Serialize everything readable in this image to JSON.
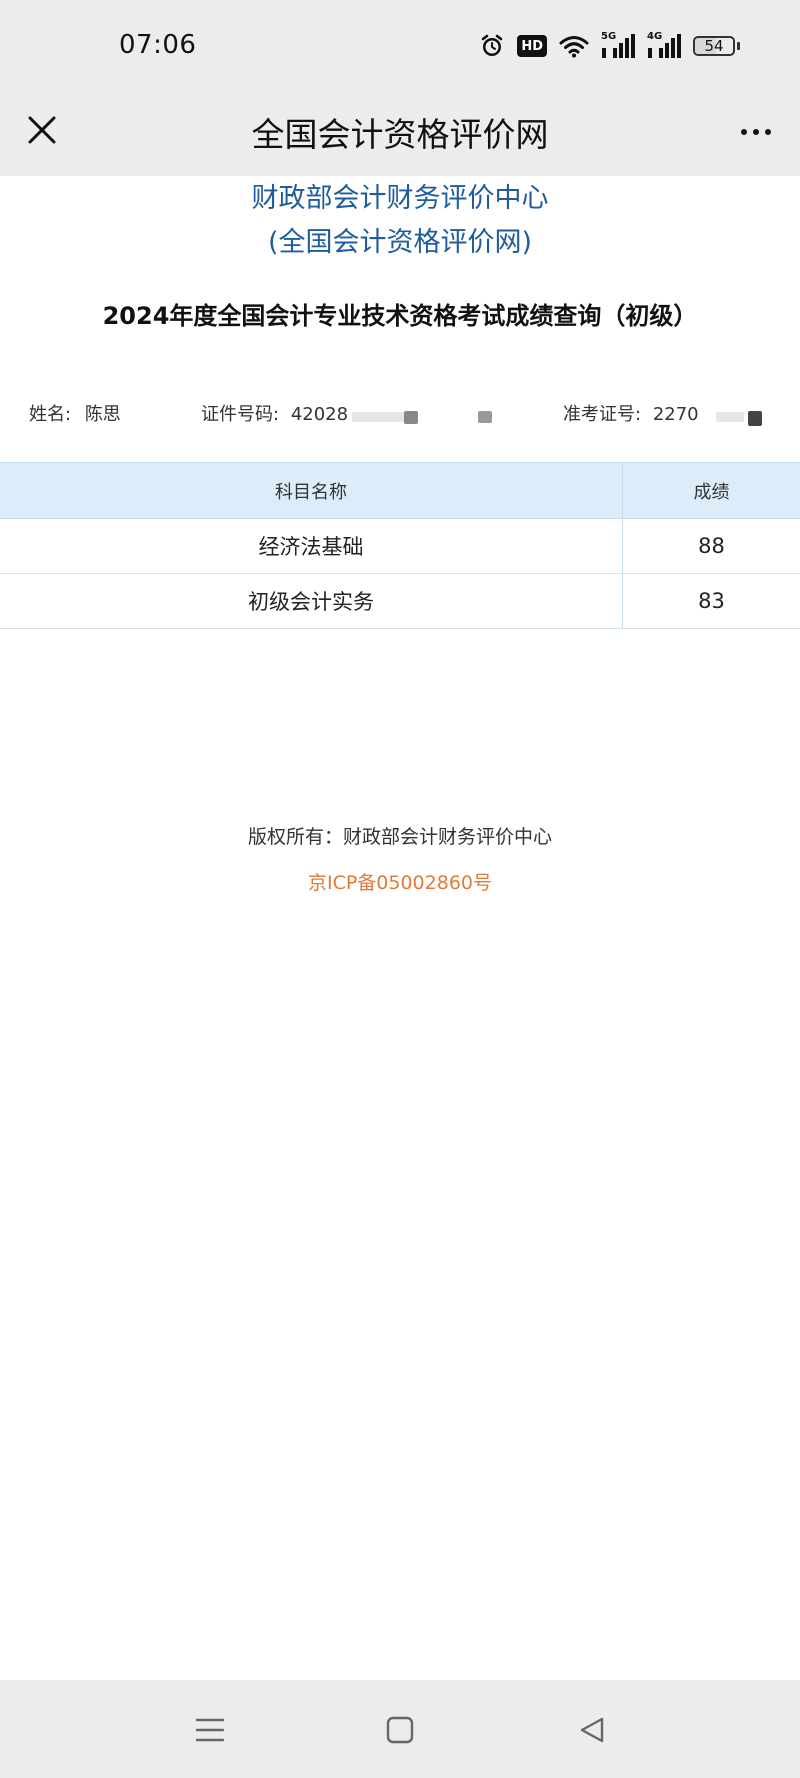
{
  "status_bar": {
    "time": "07:06",
    "hd_label": "HD",
    "net1_label": "5G",
    "net2_label": "4G",
    "battery_level": "54",
    "icons": [
      "alarm-icon",
      "hd-icon",
      "wifi-icon",
      "signal-5g-icon",
      "signal-4g-icon",
      "battery-icon"
    ]
  },
  "nav": {
    "title": "全国会计资格评价网",
    "close_icon": "close-icon",
    "more_icon": "more-dots-icon"
  },
  "header": {
    "org_name": "财政部会计财务评价中心",
    "org_sub": "(全国会计资格评价网)",
    "exam_title": "2024年度全国会计专业技术资格考试成绩查询（初级）"
  },
  "candidate": {
    "name_label": "姓名:",
    "name_value": "陈思",
    "id_label": "证件号码:",
    "id_value": "42028",
    "ticket_label": "准考证号:",
    "ticket_value": "2270"
  },
  "table": {
    "headers": {
      "subject": "科目名称",
      "score": "成绩"
    },
    "rows": [
      {
        "subject": "经济法基础",
        "score": "88"
      },
      {
        "subject": "初级会计实务",
        "score": "83"
      }
    ]
  },
  "footer": {
    "copyright": "版权所有：财政部会计财务评价中心",
    "icp": "京ICP备05002860号"
  },
  "colors": {
    "org_blue": "#1f5c9e",
    "icp_orange": "#e07b39",
    "table_header_bg": "#dcecf8",
    "bar_bg": "#ececec"
  },
  "system_nav": {
    "icons": [
      "menu-icon",
      "home-icon",
      "back-icon"
    ]
  }
}
